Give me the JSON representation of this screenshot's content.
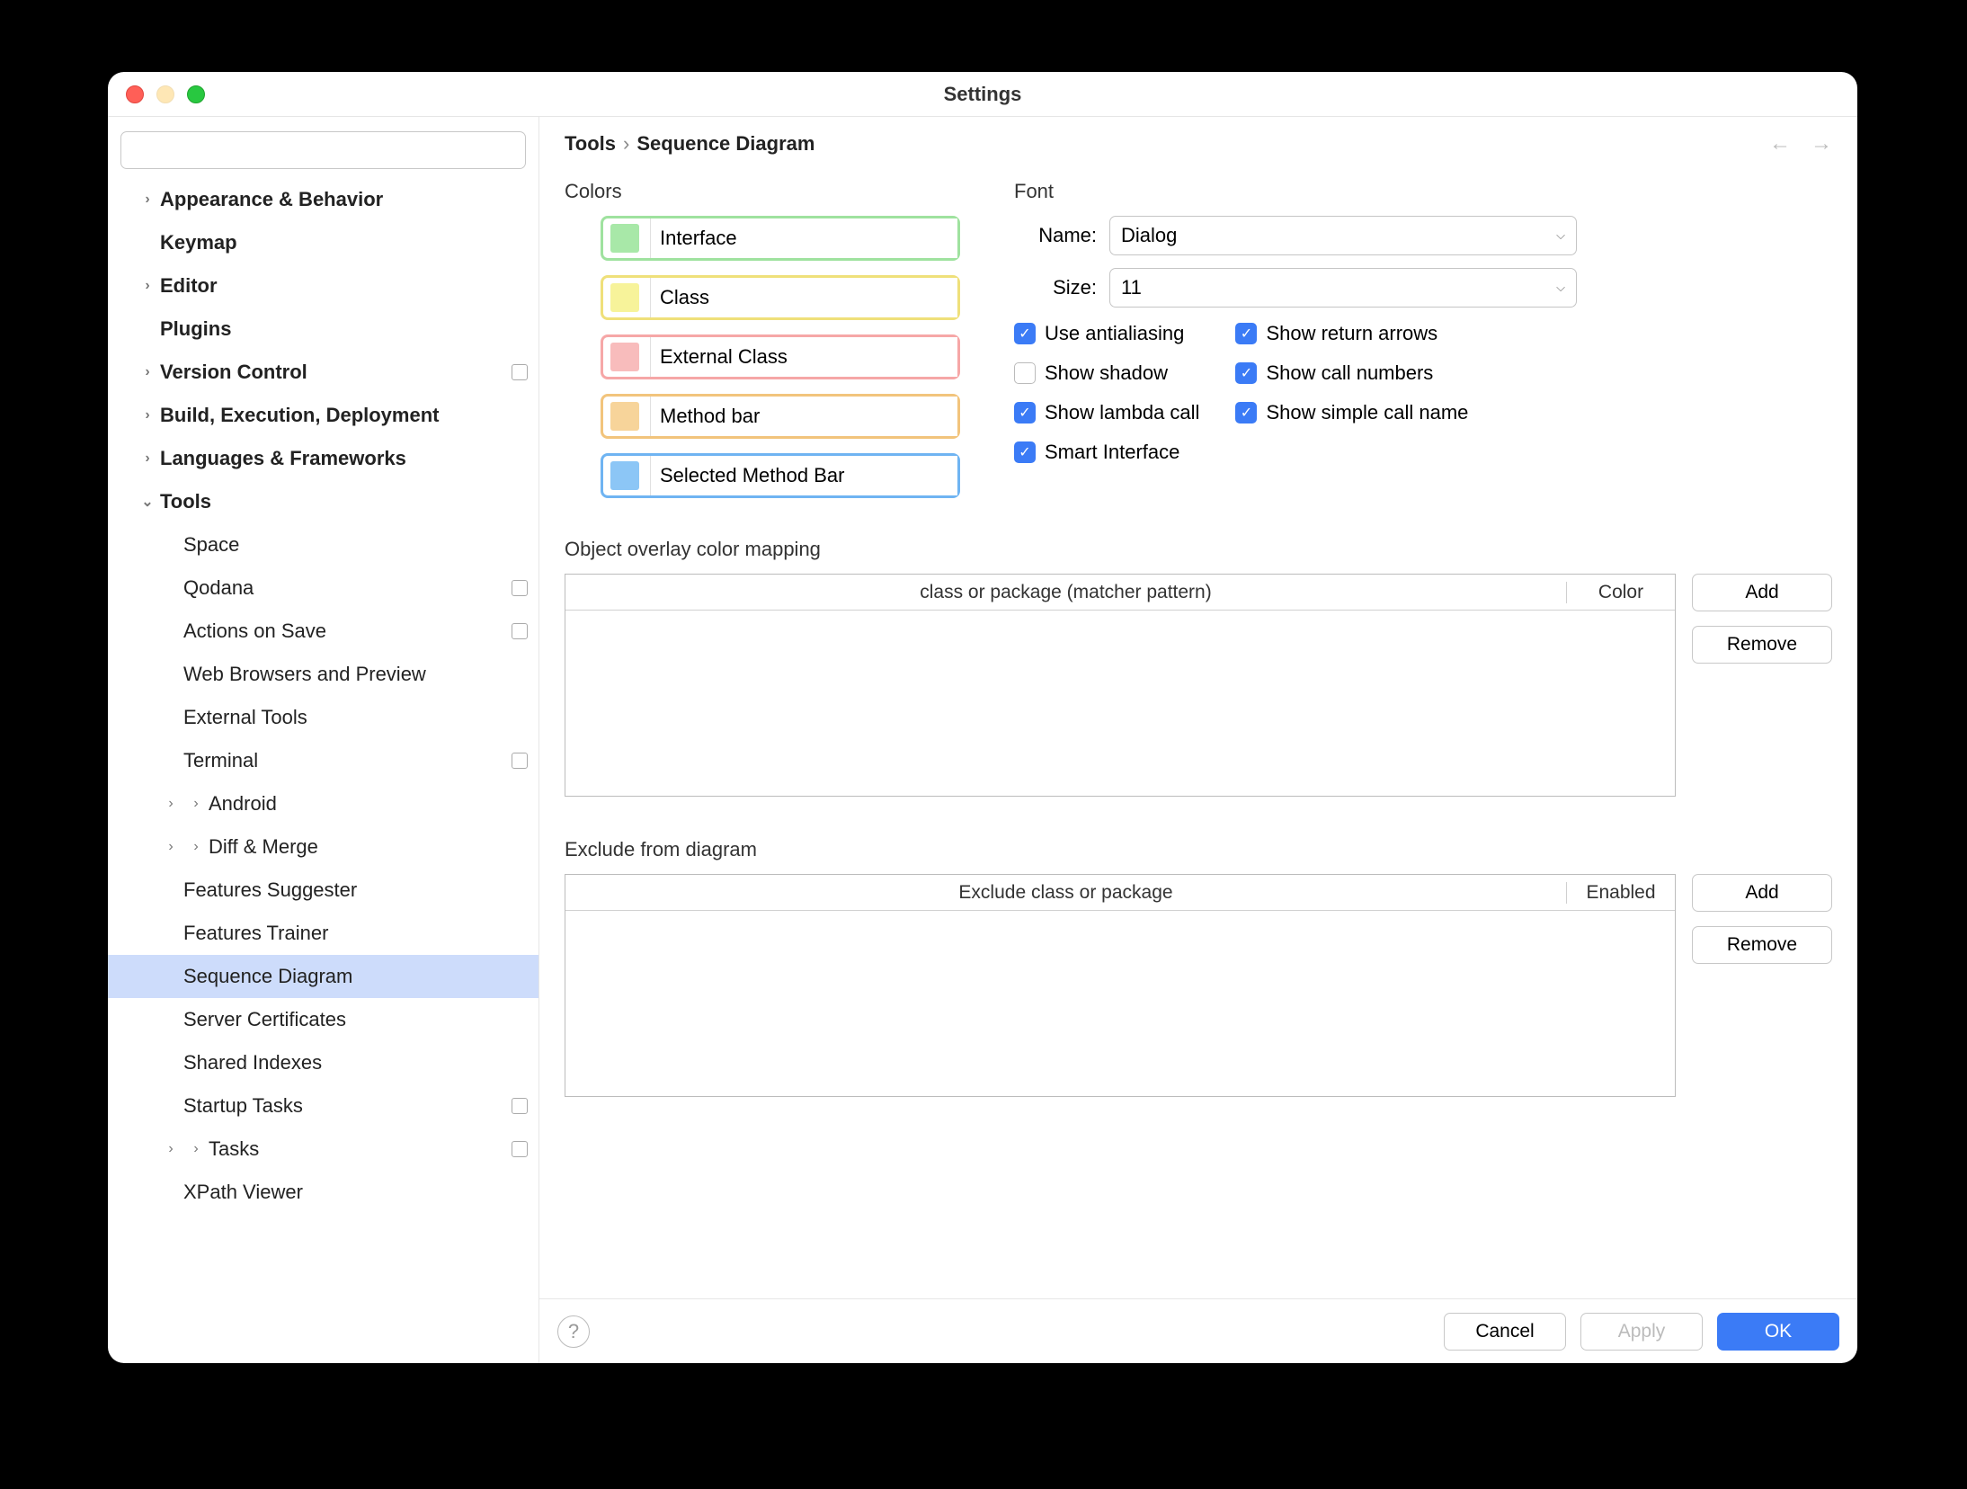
{
  "window_title": "Settings",
  "breadcrumb": {
    "root": "Tools",
    "leaf": "Sequence Diagram"
  },
  "search": {
    "placeholder": ""
  },
  "sidebar": {
    "items": [
      {
        "label": "Appearance & Behavior",
        "bold": true,
        "caret": true
      },
      {
        "label": "Keymap",
        "bold": true
      },
      {
        "label": "Editor",
        "bold": true,
        "caret": true
      },
      {
        "label": "Plugins",
        "bold": true
      },
      {
        "label": "Version Control",
        "bold": true,
        "caret": true,
        "square": true
      },
      {
        "label": "Build, Execution, Deployment",
        "bold": true,
        "caret": true
      },
      {
        "label": "Languages & Frameworks",
        "bold": true,
        "caret": true
      },
      {
        "label": "Tools",
        "bold": true,
        "caret": true,
        "expanded": true
      },
      {
        "label": "Space",
        "child": true
      },
      {
        "label": "Qodana",
        "child": true,
        "square": true
      },
      {
        "label": "Actions on Save",
        "child": true,
        "square": true
      },
      {
        "label": "Web Browsers and Preview",
        "child": true
      },
      {
        "label": "External Tools",
        "child": true
      },
      {
        "label": "Terminal",
        "child": true,
        "square": true
      },
      {
        "label": "Android",
        "child": true,
        "caret": true
      },
      {
        "label": "Diff & Merge",
        "child": true,
        "caret": true
      },
      {
        "label": "Features Suggester",
        "child": true
      },
      {
        "label": "Features Trainer",
        "child": true
      },
      {
        "label": "Sequence Diagram",
        "child": true,
        "selected": true
      },
      {
        "label": "Server Certificates",
        "child": true
      },
      {
        "label": "Shared Indexes",
        "child": true
      },
      {
        "label": "Startup Tasks",
        "child": true,
        "square": true
      },
      {
        "label": "Tasks",
        "child": true,
        "caret": true,
        "square": true
      },
      {
        "label": "XPath Viewer",
        "child": true
      }
    ]
  },
  "colors_heading": "Colors",
  "font_heading": "Font",
  "colors": [
    {
      "label": "Interface",
      "border": "#9fe29f",
      "swatch": "#a8e8a8"
    },
    {
      "label": "Class",
      "border": "#efe07a",
      "swatch": "#f7f39a"
    },
    {
      "label": "External Class",
      "border": "#f6a7a7",
      "swatch": "#f8bcbc"
    },
    {
      "label": "Method bar",
      "border": "#f2c47c",
      "swatch": "#f7d49a"
    },
    {
      "label": "Selected Method Bar",
      "border": "#6fb4f2",
      "swatch": "#8cc6f6"
    }
  ],
  "font": {
    "name_label": "Name:",
    "name_value": "Dialog",
    "size_label": "Size:",
    "size_value": "11"
  },
  "checks_left": [
    {
      "label": "Use antialiasing",
      "on": true
    },
    {
      "label": "Show shadow",
      "on": false
    },
    {
      "label": "Show lambda call",
      "on": true
    },
    {
      "label": "Smart Interface",
      "on": true
    }
  ],
  "checks_right": [
    {
      "label": "Show return arrows",
      "on": true
    },
    {
      "label": "Show call numbers",
      "on": true
    },
    {
      "label": "Show simple call name",
      "on": true
    }
  ],
  "mapping_heading": "Object overlay color mapping",
  "mapping_table": {
    "col1": "class or package (matcher pattern)",
    "col2": "Color"
  },
  "exclude_heading": "Exclude from diagram",
  "exclude_table": {
    "col1": "Exclude class or package",
    "col2": "Enabled"
  },
  "buttons": {
    "add": "Add",
    "remove": "Remove",
    "cancel": "Cancel",
    "apply": "Apply",
    "ok": "OK"
  }
}
